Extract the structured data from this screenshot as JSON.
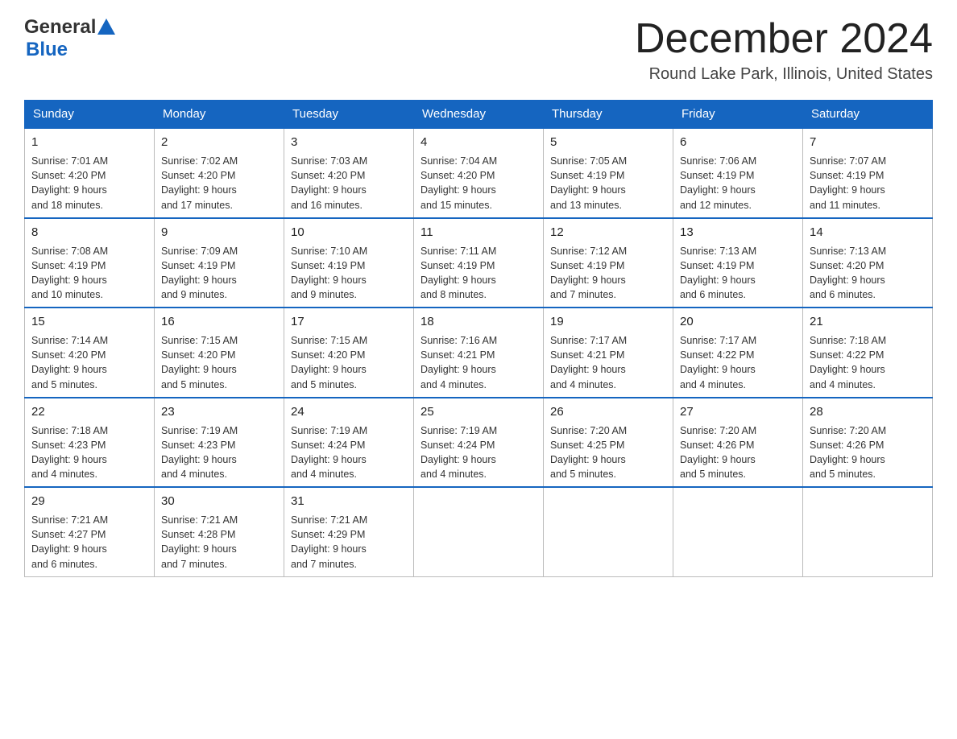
{
  "header": {
    "logo_general": "General",
    "logo_blue": "Blue",
    "month_title": "December 2024",
    "location": "Round Lake Park, Illinois, United States"
  },
  "days_of_week": [
    "Sunday",
    "Monday",
    "Tuesday",
    "Wednesday",
    "Thursday",
    "Friday",
    "Saturday"
  ],
  "weeks": [
    [
      {
        "day": "1",
        "sunrise": "7:01 AM",
        "sunset": "4:20 PM",
        "daylight": "9 hours and 18 minutes."
      },
      {
        "day": "2",
        "sunrise": "7:02 AM",
        "sunset": "4:20 PM",
        "daylight": "9 hours and 17 minutes."
      },
      {
        "day": "3",
        "sunrise": "7:03 AM",
        "sunset": "4:20 PM",
        "daylight": "9 hours and 16 minutes."
      },
      {
        "day": "4",
        "sunrise": "7:04 AM",
        "sunset": "4:20 PM",
        "daylight": "9 hours and 15 minutes."
      },
      {
        "day": "5",
        "sunrise": "7:05 AM",
        "sunset": "4:19 PM",
        "daylight": "9 hours and 13 minutes."
      },
      {
        "day": "6",
        "sunrise": "7:06 AM",
        "sunset": "4:19 PM",
        "daylight": "9 hours and 12 minutes."
      },
      {
        "day": "7",
        "sunrise": "7:07 AM",
        "sunset": "4:19 PM",
        "daylight": "9 hours and 11 minutes."
      }
    ],
    [
      {
        "day": "8",
        "sunrise": "7:08 AM",
        "sunset": "4:19 PM",
        "daylight": "9 hours and 10 minutes."
      },
      {
        "day": "9",
        "sunrise": "7:09 AM",
        "sunset": "4:19 PM",
        "daylight": "9 hours and 9 minutes."
      },
      {
        "day": "10",
        "sunrise": "7:10 AM",
        "sunset": "4:19 PM",
        "daylight": "9 hours and 9 minutes."
      },
      {
        "day": "11",
        "sunrise": "7:11 AM",
        "sunset": "4:19 PM",
        "daylight": "9 hours and 8 minutes."
      },
      {
        "day": "12",
        "sunrise": "7:12 AM",
        "sunset": "4:19 PM",
        "daylight": "9 hours and 7 minutes."
      },
      {
        "day": "13",
        "sunrise": "7:13 AM",
        "sunset": "4:19 PM",
        "daylight": "9 hours and 6 minutes."
      },
      {
        "day": "14",
        "sunrise": "7:13 AM",
        "sunset": "4:20 PM",
        "daylight": "9 hours and 6 minutes."
      }
    ],
    [
      {
        "day": "15",
        "sunrise": "7:14 AM",
        "sunset": "4:20 PM",
        "daylight": "9 hours and 5 minutes."
      },
      {
        "day": "16",
        "sunrise": "7:15 AM",
        "sunset": "4:20 PM",
        "daylight": "9 hours and 5 minutes."
      },
      {
        "day": "17",
        "sunrise": "7:15 AM",
        "sunset": "4:20 PM",
        "daylight": "9 hours and 5 minutes."
      },
      {
        "day": "18",
        "sunrise": "7:16 AM",
        "sunset": "4:21 PM",
        "daylight": "9 hours and 4 minutes."
      },
      {
        "day": "19",
        "sunrise": "7:17 AM",
        "sunset": "4:21 PM",
        "daylight": "9 hours and 4 minutes."
      },
      {
        "day": "20",
        "sunrise": "7:17 AM",
        "sunset": "4:22 PM",
        "daylight": "9 hours and 4 minutes."
      },
      {
        "day": "21",
        "sunrise": "7:18 AM",
        "sunset": "4:22 PM",
        "daylight": "9 hours and 4 minutes."
      }
    ],
    [
      {
        "day": "22",
        "sunrise": "7:18 AM",
        "sunset": "4:23 PM",
        "daylight": "9 hours and 4 minutes."
      },
      {
        "day": "23",
        "sunrise": "7:19 AM",
        "sunset": "4:23 PM",
        "daylight": "9 hours and 4 minutes."
      },
      {
        "day": "24",
        "sunrise": "7:19 AM",
        "sunset": "4:24 PM",
        "daylight": "9 hours and 4 minutes."
      },
      {
        "day": "25",
        "sunrise": "7:19 AM",
        "sunset": "4:24 PM",
        "daylight": "9 hours and 4 minutes."
      },
      {
        "day": "26",
        "sunrise": "7:20 AM",
        "sunset": "4:25 PM",
        "daylight": "9 hours and 5 minutes."
      },
      {
        "day": "27",
        "sunrise": "7:20 AM",
        "sunset": "4:26 PM",
        "daylight": "9 hours and 5 minutes."
      },
      {
        "day": "28",
        "sunrise": "7:20 AM",
        "sunset": "4:26 PM",
        "daylight": "9 hours and 5 minutes."
      }
    ],
    [
      {
        "day": "29",
        "sunrise": "7:21 AM",
        "sunset": "4:27 PM",
        "daylight": "9 hours and 6 minutes."
      },
      {
        "day": "30",
        "sunrise": "7:21 AM",
        "sunset": "4:28 PM",
        "daylight": "9 hours and 7 minutes."
      },
      {
        "day": "31",
        "sunrise": "7:21 AM",
        "sunset": "4:29 PM",
        "daylight": "9 hours and 7 minutes."
      },
      null,
      null,
      null,
      null
    ]
  ],
  "labels": {
    "sunrise": "Sunrise:",
    "sunset": "Sunset:",
    "daylight": "Daylight:"
  }
}
